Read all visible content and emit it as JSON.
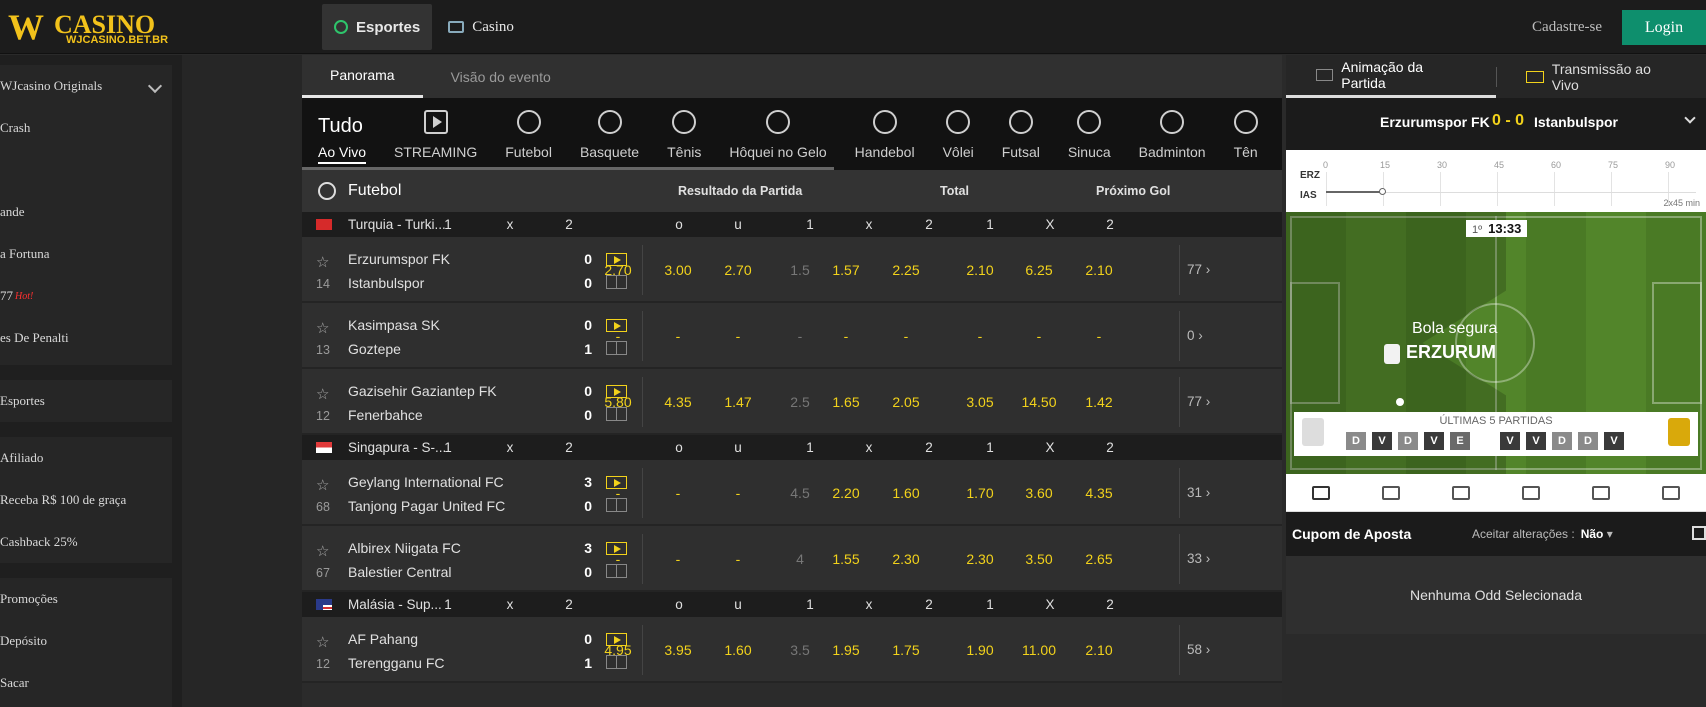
{
  "header": {
    "logo_wordmark": "WJCASINO",
    "logo_url": "WJCASINO.BET.BR",
    "tabs": [
      "Esportes",
      "Casino"
    ],
    "register": "Cadastre-se",
    "login": "Login"
  },
  "sidebar": {
    "originals": "WJcasino Originals",
    "games": [
      "Crash",
      "",
      "ande",
      "a Fortuna",
      "77",
      "es De Penalti"
    ],
    "hot_badge": "Hot!",
    "sports": "Esportes",
    "affiliate": [
      "Afiliado",
      "Receba R$ 100 de graça",
      "Cashback 25%"
    ],
    "account": [
      "Promoções",
      "Depósito",
      "Sacar"
    ]
  },
  "subtabs": [
    "Panorama",
    "Visão do evento"
  ],
  "sports_bar": {
    "tudo_big": "Tudo",
    "tudo_small": "Ao Vivo",
    "items": [
      "STREAMING",
      "Futebol",
      "Basquete",
      "Tênis",
      "Hôquei no Gelo",
      "Handebol",
      "Vôlei",
      "Futsal",
      "Sinuca",
      "Badminton",
      "Tên"
    ]
  },
  "market_header": {
    "sport": "Futebol",
    "col1": "Resultado da Partida",
    "col2": "Total",
    "col3": "Próximo Gol"
  },
  "leagues": [
    {
      "name": "Turquia - Turki...",
      "cols": [
        "1",
        "x",
        "2",
        "o",
        "u",
        "1",
        "x",
        "2",
        "1",
        "X",
        "2"
      ],
      "matches": [
        {
          "min": "14",
          "home": "Erzurumspor FK",
          "away": "Istanbulspor",
          "hs": "0",
          "as": "0",
          "odds": [
            "2.70",
            "3.00",
            "2.70",
            "1.5",
            "1.57",
            "2.25",
            "2.10",
            "6.25",
            "2.10"
          ],
          "more": "77 ›"
        },
        {
          "min": "13",
          "home": "Kasimpasa SK",
          "away": "Goztepe",
          "hs": "0",
          "as": "1",
          "odds": [
            "-",
            "-",
            "-",
            "-",
            "-",
            "-",
            "-",
            "-",
            "-"
          ],
          "more": "0 ›"
        },
        {
          "min": "12",
          "home": "Gazisehir Gaziantep FK",
          "away": "Fenerbahce",
          "hs": "0",
          "as": "0",
          "odds": [
            "5.80",
            "4.35",
            "1.47",
            "2.5",
            "1.65",
            "2.05",
            "3.05",
            "14.50",
            "1.42"
          ],
          "more": "77 ›"
        }
      ]
    },
    {
      "name": "Singapura - S-...",
      "cols": [
        "1",
        "x",
        "2",
        "o",
        "u",
        "1",
        "x",
        "2",
        "1",
        "X",
        "2"
      ],
      "matches": [
        {
          "min": "68",
          "home": "Geylang International FC",
          "away": "Tanjong Pagar United FC",
          "hs": "3",
          "as": "0",
          "odds": [
            "-",
            "-",
            "-",
            "4.5",
            "2.20",
            "1.60",
            "1.70",
            "3.60",
            "4.35"
          ],
          "more": "31 ›"
        },
        {
          "min": "67",
          "home": "Albirex Niigata FC",
          "away": "Balestier Central",
          "hs": "3",
          "as": "0",
          "odds": [
            "-",
            "-",
            "-",
            "4",
            "1.55",
            "2.30",
            "2.30",
            "3.50",
            "2.65"
          ],
          "more": "33 ›"
        }
      ]
    },
    {
      "name": "Malásia - Sup...",
      "cols": [
        "1",
        "x",
        "2",
        "o",
        "u",
        "1",
        "x",
        "2",
        "1",
        "X",
        "2"
      ],
      "matches": [
        {
          "min": "12",
          "home": "AF Pahang",
          "away": "Terengganu FC",
          "hs": "0",
          "as": "1",
          "odds": [
            "4.95",
            "3.95",
            "1.60",
            "3.5",
            "1.95",
            "1.75",
            "1.90",
            "11.00",
            "2.10"
          ],
          "more": "58 ›"
        }
      ]
    }
  ],
  "right": {
    "tab1": "Animação da Partida",
    "tab2": "Transmissão ao Vivo",
    "home": "Erzurumspor FK",
    "score": "0 - 0",
    "away": "Istanbulspor",
    "timeline": {
      "home_abbr": "ERZ",
      "away_abbr": "IAS",
      "ticks": [
        "0",
        "15",
        "30",
        "45",
        "60",
        "75",
        "90"
      ],
      "format": "2x45 min"
    },
    "pitch": {
      "period": "1º",
      "clock": "13:33",
      "status": "Bola segura",
      "team": "ERZURUM",
      "last5_title": "ÚLTIMAS 5 PARTIDAS",
      "home_last5": [
        "D",
        "V",
        "D",
        "V",
        "E"
      ],
      "away_last5": [
        "V",
        "V",
        "D",
        "D",
        "V"
      ]
    },
    "betslip": {
      "title": "Cupom de Aposta",
      "accept": "Aceitar alterações :",
      "accept_value": "Não",
      "empty": "Nenhuma Odd Selecionada"
    }
  },
  "colors": {
    "accent": "#f2d21b",
    "login": "#0e8f6d",
    "hot": "#ff3030"
  }
}
